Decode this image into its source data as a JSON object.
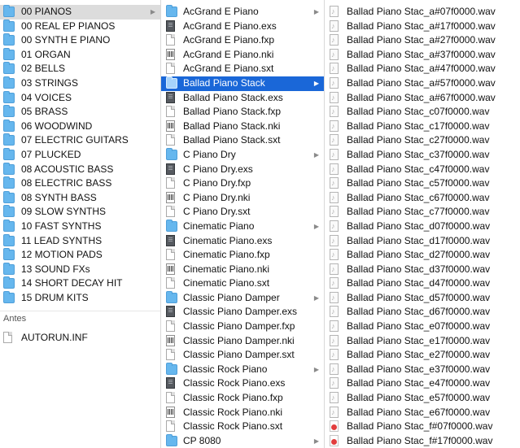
{
  "columns": [
    {
      "items": [
        {
          "label": "00 PIANOS",
          "icon": "folder-icon",
          "arrow": true,
          "selected": "gray"
        },
        {
          "label": "00 REAL EP PIANOS",
          "icon": "folder-icon"
        },
        {
          "label": "00 SYNTH E PIANO",
          "icon": "folder-icon"
        },
        {
          "label": "01 ORGAN",
          "icon": "folder-icon"
        },
        {
          "label": "02 BELLS",
          "icon": "folder-icon"
        },
        {
          "label": "03 STRINGS",
          "icon": "folder-icon"
        },
        {
          "label": "04 VOICES",
          "icon": "folder-icon"
        },
        {
          "label": "05 BRASS",
          "icon": "folder-icon"
        },
        {
          "label": "06 WOODWIND",
          "icon": "folder-icon"
        },
        {
          "label": "07 ELECTRIC GUITARS",
          "icon": "folder-icon"
        },
        {
          "label": "07 PLUCKED",
          "icon": "folder-icon"
        },
        {
          "label": "08 ACOUSTIC BASS",
          "icon": "folder-icon"
        },
        {
          "label": "08 ELECTRIC BASS",
          "icon": "folder-icon"
        },
        {
          "label": "08 SYNTH BASS",
          "icon": "folder-icon"
        },
        {
          "label": "09 SLOW SYNTHS",
          "icon": "folder-icon"
        },
        {
          "label": "10 FAST SYNTHS",
          "icon": "folder-icon"
        },
        {
          "label": "11 LEAD SYNTHS",
          "icon": "folder-icon"
        },
        {
          "label": "12 MOTION PADS",
          "icon": "folder-icon"
        },
        {
          "label": "13 SOUND FXs",
          "icon": "folder-icon"
        },
        {
          "label": "14 SHORT DECAY HIT",
          "icon": "folder-icon"
        },
        {
          "label": "15 DRUM KITS",
          "icon": "folder-icon"
        }
      ],
      "section_label": "Antes",
      "extra_item": {
        "label": "AUTORUN.INF",
        "icon": "document-icon"
      }
    },
    {
      "items": [
        {
          "label": "AcGrand E Piano",
          "icon": "folder-icon",
          "arrow": true
        },
        {
          "label": "AcGrand E Piano.exs",
          "icon": "exs-file-icon"
        },
        {
          "label": "AcGrand E Piano.fxp",
          "icon": "document-icon"
        },
        {
          "label": "AcGrand E Piano.nki",
          "icon": "nki-file-icon"
        },
        {
          "label": "AcGrand E Piano.sxt",
          "icon": "document-icon"
        },
        {
          "label": "Ballad Piano Stack",
          "icon": "folder-icon",
          "arrow": true,
          "selected": "blue"
        },
        {
          "label": "Ballad Piano Stack.exs",
          "icon": "exs-file-icon"
        },
        {
          "label": "Ballad Piano Stack.fxp",
          "icon": "document-icon"
        },
        {
          "label": "Ballad Piano Stack.nki",
          "icon": "nki-file-icon"
        },
        {
          "label": "Ballad Piano Stack.sxt",
          "icon": "document-icon"
        },
        {
          "label": "C Piano Dry",
          "icon": "folder-icon",
          "arrow": true
        },
        {
          "label": "C Piano Dry.exs",
          "icon": "exs-file-icon"
        },
        {
          "label": "C Piano Dry.fxp",
          "icon": "document-icon"
        },
        {
          "label": "C Piano Dry.nki",
          "icon": "nki-file-icon"
        },
        {
          "label": "C Piano Dry.sxt",
          "icon": "document-icon"
        },
        {
          "label": "Cinematic Piano",
          "icon": "folder-icon",
          "arrow": true
        },
        {
          "label": "Cinematic Piano.exs",
          "icon": "exs-file-icon"
        },
        {
          "label": "Cinematic Piano.fxp",
          "icon": "document-icon"
        },
        {
          "label": "Cinematic Piano.nki",
          "icon": "nki-file-icon"
        },
        {
          "label": "Cinematic Piano.sxt",
          "icon": "document-icon"
        },
        {
          "label": "Classic Piano Damper",
          "icon": "folder-icon",
          "arrow": true
        },
        {
          "label": "Classic Piano Damper.exs",
          "icon": "exs-file-icon"
        },
        {
          "label": "Classic Piano Damper.fxp",
          "icon": "document-icon"
        },
        {
          "label": "Classic Piano Damper.nki",
          "icon": "nki-file-icon"
        },
        {
          "label": "Classic Piano Damper.sxt",
          "icon": "document-icon"
        },
        {
          "label": "Classic Rock Piano",
          "icon": "folder-icon",
          "arrow": true
        },
        {
          "label": "Classic Rock Piano.exs",
          "icon": "exs-file-icon"
        },
        {
          "label": "Classic Rock Piano.fxp",
          "icon": "document-icon"
        },
        {
          "label": "Classic Rock Piano.nki",
          "icon": "nki-file-icon"
        },
        {
          "label": "Classic Rock Piano.sxt",
          "icon": "document-icon"
        },
        {
          "label": "CP 8080",
          "icon": "folder-icon",
          "arrow": true
        }
      ]
    },
    {
      "items": [
        {
          "label": "Ballad Piano Stac_a#07f0000.wav",
          "icon": "wav-file-icon"
        },
        {
          "label": "Ballad Piano Stac_a#17f0000.wav",
          "icon": "wav-file-icon"
        },
        {
          "label": "Ballad Piano Stac_a#27f0000.wav",
          "icon": "wav-file-icon"
        },
        {
          "label": "Ballad Piano Stac_a#37f0000.wav",
          "icon": "wav-file-icon"
        },
        {
          "label": "Ballad Piano Stac_a#47f0000.wav",
          "icon": "wav-file-icon"
        },
        {
          "label": "Ballad Piano Stac_a#57f0000.wav",
          "icon": "wav-file-icon"
        },
        {
          "label": "Ballad Piano Stac_a#67f0000.wav",
          "icon": "wav-file-icon"
        },
        {
          "label": "Ballad Piano Stac_c07f0000.wav",
          "icon": "wav-file-icon"
        },
        {
          "label": "Ballad Piano Stac_c17f0000.wav",
          "icon": "wav-file-icon"
        },
        {
          "label": "Ballad Piano Stac_c27f0000.wav",
          "icon": "wav-file-icon"
        },
        {
          "label": "Ballad Piano Stac_c37f0000.wav",
          "icon": "wav-file-icon"
        },
        {
          "label": "Ballad Piano Stac_c47f0000.wav",
          "icon": "wav-file-icon"
        },
        {
          "label": "Ballad Piano Stac_c57f0000.wav",
          "icon": "wav-file-icon"
        },
        {
          "label": "Ballad Piano Stac_c67f0000.wav",
          "icon": "wav-file-icon"
        },
        {
          "label": "Ballad Piano Stac_c77f0000.wav",
          "icon": "wav-file-icon"
        },
        {
          "label": "Ballad Piano Stac_d07f0000.wav",
          "icon": "wav-file-icon"
        },
        {
          "label": "Ballad Piano Stac_d17f0000.wav",
          "icon": "wav-file-icon"
        },
        {
          "label": "Ballad Piano Stac_d27f0000.wav",
          "icon": "wav-file-icon"
        },
        {
          "label": "Ballad Piano Stac_d37f0000.wav",
          "icon": "wav-file-icon"
        },
        {
          "label": "Ballad Piano Stac_d47f0000.wav",
          "icon": "wav-file-icon"
        },
        {
          "label": "Ballad Piano Stac_d57f0000.wav",
          "icon": "wav-file-icon"
        },
        {
          "label": "Ballad Piano Stac_d67f0000.wav",
          "icon": "wav-file-icon"
        },
        {
          "label": "Ballad Piano Stac_e07f0000.wav",
          "icon": "wav-file-icon"
        },
        {
          "label": "Ballad Piano Stac_e17f0000.wav",
          "icon": "wav-file-icon"
        },
        {
          "label": "Ballad Piano Stac_e27f0000.wav",
          "icon": "wav-file-icon"
        },
        {
          "label": "Ballad Piano Stac_e37f0000.wav",
          "icon": "wav-file-icon"
        },
        {
          "label": "Ballad Piano Stac_e47f0000.wav",
          "icon": "wav-file-icon"
        },
        {
          "label": "Ballad Piano Stac_e57f0000.wav",
          "icon": "wav-file-icon"
        },
        {
          "label": "Ballad Piano Stac_e67f0000.wav",
          "icon": "wav-file-icon"
        },
        {
          "label": "Ballad Piano Stac_f#07f0000.wav",
          "icon": "wav-red-file-icon"
        },
        {
          "label": "Ballad Piano Stac_f#17f0000.wav",
          "icon": "wav-red-file-icon"
        }
      ]
    }
  ],
  "colors": {
    "selection_blue": "#1a67d8",
    "selection_gray": "#dcdcdc",
    "folder_blue": "#66b7ee"
  }
}
